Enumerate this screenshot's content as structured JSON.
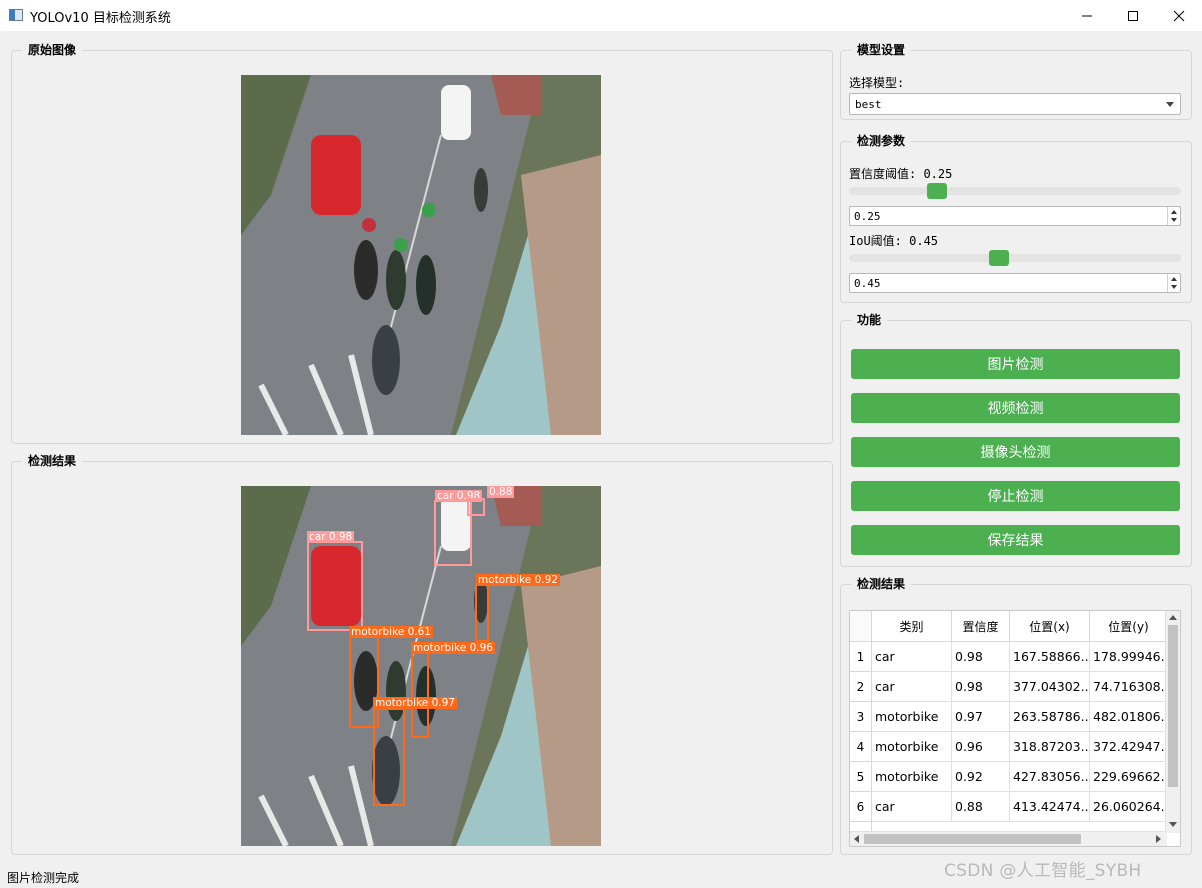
{
  "window": {
    "title": "YOLOv10 目标检测系统"
  },
  "colors": {
    "accent": "#4caf50",
    "car_box": "#ff9a9a",
    "motorbike_box": "#ff6a1a"
  },
  "panels": {
    "original": {
      "title": "原始图像"
    },
    "result": {
      "title": "检测结果"
    },
    "model": {
      "title": "模型设置",
      "select_label": "选择模型:",
      "selected": "best"
    },
    "params": {
      "title": "检测参数",
      "conf_label": "置信度阈值: 0.25",
      "conf_value": "0.25",
      "conf_level": 0.25,
      "iou_label": "IoU阈值: 0.45",
      "iou_value": "0.45",
      "iou_level": 0.45
    },
    "functions": {
      "title": "功能",
      "buttons": [
        "图片检测",
        "视频检测",
        "摄像头检测",
        "停止检测",
        "保存结果"
      ]
    },
    "results_table": {
      "title": "检测结果",
      "headers": [
        "类别",
        "置信度",
        "位置(x)",
        "位置(y)"
      ],
      "rows": [
        [
          "car",
          "0.98",
          "167.58866...",
          "178.99946..."
        ],
        [
          "car",
          "0.98",
          "377.04302...",
          "74.716308..."
        ],
        [
          "motorbike",
          "0.97",
          "263.58786...",
          "482.01806..."
        ],
        [
          "motorbike",
          "0.96",
          "318.87203...",
          "372.42947..."
        ],
        [
          "motorbike",
          "0.92",
          "427.83056...",
          "229.69662..."
        ],
        [
          "car",
          "0.88",
          "413.42474...",
          "26.060264..."
        ]
      ]
    }
  },
  "detections": [
    {
      "label": "car 0.98"
    },
    {
      "label": "car 0.98"
    },
    {
      "label": "0.88"
    },
    {
      "label": "motorbike 0.92"
    },
    {
      "label": "motorbike 0.61"
    },
    {
      "label": "motorbike 0.96"
    },
    {
      "label": "motorbike 0.97"
    }
  ],
  "status": {
    "text": "图片检测完成"
  },
  "watermark": "CSDN @人工智能_SYBH"
}
